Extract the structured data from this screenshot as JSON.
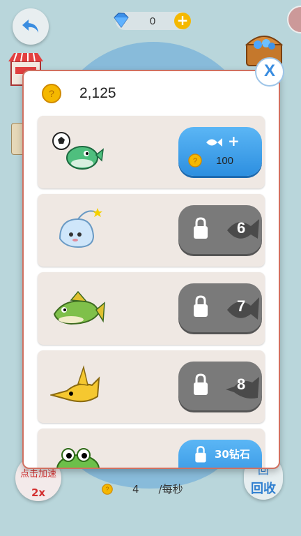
{
  "header": {
    "gem_count": "0",
    "gem_plus": "+"
  },
  "panel": {
    "balance": "2,125",
    "close_label": "X",
    "rows": [
      {
        "type": "buy",
        "fish": "anglerfish-with-ball",
        "price": "100",
        "action": "+"
      },
      {
        "type": "locked",
        "fish": "ghost-anglerfish",
        "level": "6"
      },
      {
        "type": "locked",
        "fish": "green-bass",
        "level": "7"
      },
      {
        "type": "locked",
        "fish": "yellow-swordfish",
        "level": "8"
      },
      {
        "type": "partial",
        "fish": "green-frog-fish",
        "label": "30钻石"
      }
    ]
  },
  "bottom": {
    "speed_label": "点击加速",
    "speed_mult": "2x",
    "rate_value": "4",
    "rate_unit": "/每秒",
    "recycle_glyph": "回",
    "recycle_label": "回收"
  },
  "colors": {
    "buy_button": "#3fa2ee",
    "lock_button": "#7a7a7a",
    "row_bg": "#efe8e3",
    "coin": "#f5b800",
    "speed_text": "#d33030"
  }
}
